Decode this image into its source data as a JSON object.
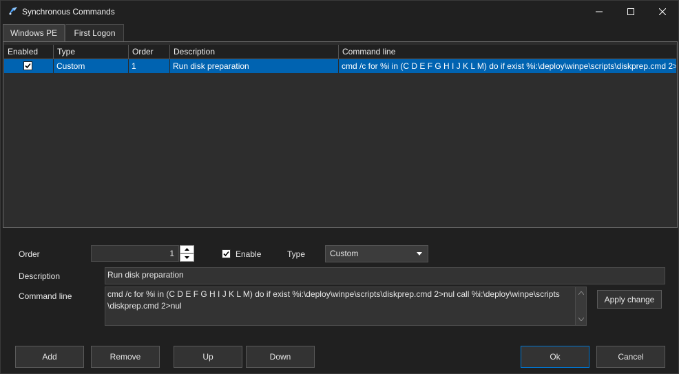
{
  "window": {
    "title": "Synchronous Commands",
    "icon": "app-icon"
  },
  "tabs": [
    {
      "label": "Windows PE",
      "active": true
    },
    {
      "label": "First Logon",
      "active": false
    }
  ],
  "grid": {
    "columns": [
      "Enabled",
      "Type",
      "Order",
      "Description",
      "Command line"
    ],
    "rows": [
      {
        "enabled": true,
        "type": "Custom",
        "order": "1",
        "description": "Run disk preparation",
        "command_line": "cmd /c for %i in (C D E F G H I J K L M) do if exist %i:\\deploy\\winpe\\scripts\\diskprep.cmd 2>"
      }
    ],
    "selection_color": "#0063b1"
  },
  "form": {
    "order_label": "Order",
    "order_value": "1",
    "enable_label": "Enable",
    "enable_checked": true,
    "type_label": "Type",
    "type_value": "Custom",
    "description_label": "Description",
    "description_value": "Run disk preparation",
    "command_line_label": "Command line",
    "command_line_value": "cmd /c for %i in (C D E F G H I J K L M) do if exist %i:\\deploy\\winpe\\scripts\\diskprep.cmd 2>nul call %i:\\deploy\\winpe\\scripts\n\\diskprep.cmd 2>nul",
    "apply_label": "Apply change"
  },
  "buttons": {
    "add": "Add",
    "remove": "Remove",
    "up": "Up",
    "down": "Down",
    "ok": "Ok",
    "cancel": "Cancel"
  },
  "colors": {
    "accent": "#0078d4",
    "background": "#202020"
  }
}
